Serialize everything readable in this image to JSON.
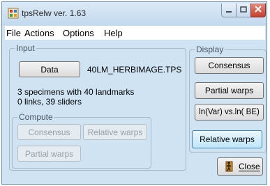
{
  "window": {
    "title": "tpsRelw ver. 1.63"
  },
  "menubar": {
    "items": [
      "File",
      "Actions",
      "Options",
      "Help"
    ]
  },
  "input_group": {
    "label": "Input",
    "data_button": "Data",
    "filename": "40LM_HERBIMAGE.TPS",
    "specimens_text": "3 specimens with 40 landmarks",
    "links_text": "0 links, 39 sliders"
  },
  "compute_group": {
    "label": "Compute",
    "consensus_button": "Consensus",
    "relative_warps_button": "Relative warps",
    "partial_warps_button": "Partial warps"
  },
  "display_group": {
    "label": "Display",
    "consensus_button": "Consensus",
    "partial_warps_button": "Partial warps",
    "ln_var_button": "ln(Var) vs.ln( BE)",
    "relative_warps_button": "Relative warps"
  },
  "close_button": {
    "label": "Close",
    "icon": "door-exit-icon"
  },
  "colors": {
    "window_bg": "#cfe3f3",
    "close_button_red": "#c4402d",
    "focused_button": "#bee6fd"
  }
}
